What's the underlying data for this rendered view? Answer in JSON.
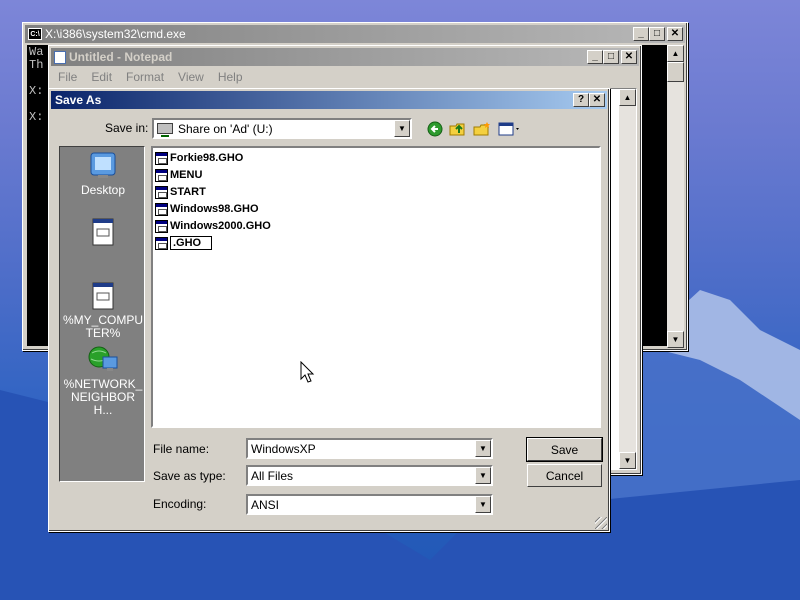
{
  "cmd": {
    "title": "X:\\i386\\system32\\cmd.exe",
    "lines": [
      "Wa",
      "Th",
      "",
      "X:",
      "",
      "X:"
    ]
  },
  "notepad": {
    "title": "Untitled - Notepad",
    "menu": [
      "File",
      "Edit",
      "Format",
      "View",
      "Help"
    ]
  },
  "saveas": {
    "title": "Save As",
    "save_in_label": "Save in:",
    "save_in_value": "Share on 'Ad' (U:)",
    "places": [
      {
        "label": "Desktop",
        "icon": "desktop-icon"
      },
      {
        "label": "",
        "icon": "document-icon"
      },
      {
        "label": "%MY_COMPUTER%",
        "icon": "computer-icon"
      },
      {
        "label": "%NETWORK_NEIGHBORH...",
        "icon": "network-icon"
      }
    ],
    "files": [
      "Forkie98.GHO",
      "MENU",
      "START",
      "Windows98.GHO",
      "Windows2000.GHO",
      ".GHO"
    ],
    "file_name_label": "File name:",
    "file_name_value": "WindowsXP",
    "save_type_label": "Save as type:",
    "save_type_value": "All Files",
    "encoding_label": "Encoding:",
    "encoding_value": "ANSI",
    "save_button": "Save",
    "cancel_button": "Cancel"
  },
  "colors": {
    "active_title": "#0a246a",
    "inactive_title": "#808080",
    "dialog_face": "#d4d0c8"
  }
}
